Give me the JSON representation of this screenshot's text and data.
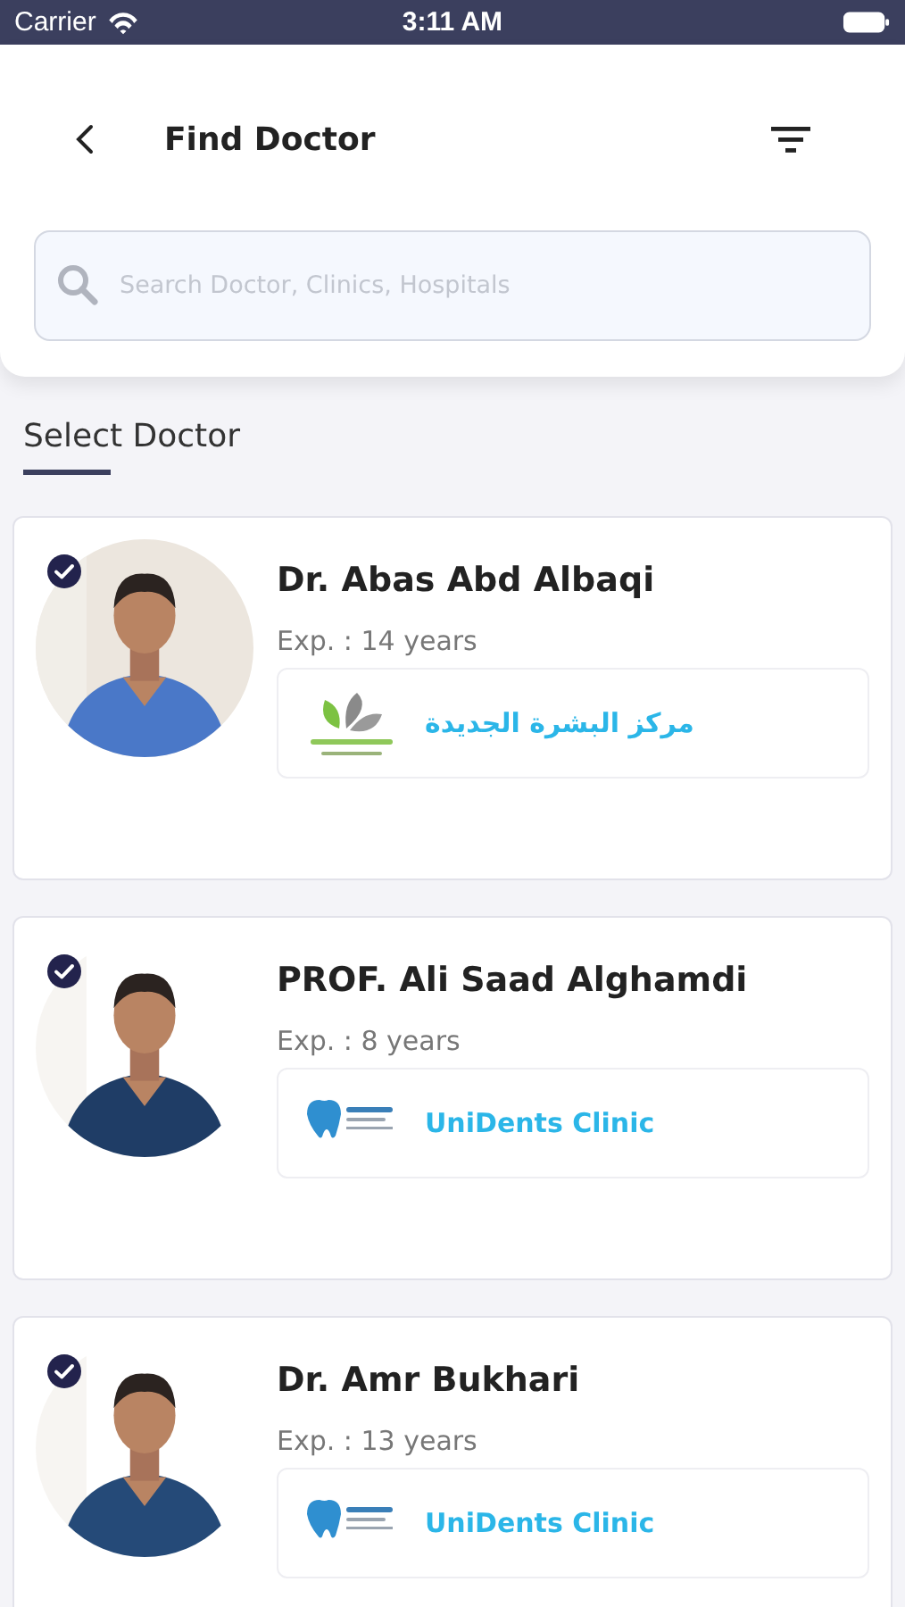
{
  "status_bar": {
    "carrier": "Carrier",
    "time": "3:11 AM"
  },
  "header": {
    "title": "Find Doctor"
  },
  "search": {
    "placeholder": "Search Doctor, Clinics, Hospitals"
  },
  "section": {
    "title": "Select Doctor"
  },
  "doctors": [
    {
      "name": "Dr. Abas Abd Albaqi",
      "experience": "Exp. : 14 years",
      "selected": true,
      "clinic": {
        "name": "مركز البشرة الجديدة",
        "kind": "leaf"
      }
    },
    {
      "name": "PROF. Ali Saad Alghamdi",
      "experience": "Exp. : 8 years",
      "selected": true,
      "clinic": {
        "name": "UniDents Clinic",
        "kind": "tooth"
      }
    },
    {
      "name": "Dr. Amr Bukhari",
      "experience": "Exp. : 13 years",
      "selected": true,
      "clinic": {
        "name": "UniDents Clinic",
        "kind": "tooth"
      }
    }
  ]
}
